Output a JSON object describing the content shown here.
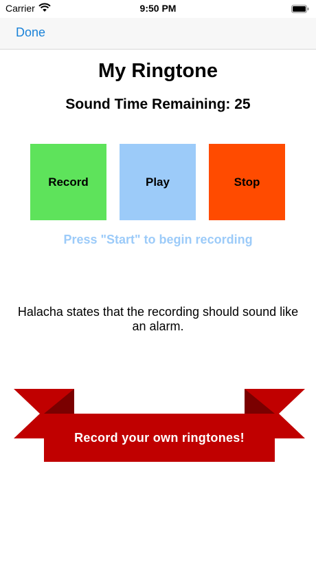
{
  "status_bar": {
    "carrier": "Carrier",
    "time": "9:50 PM",
    "icons": [
      "wifi-icon",
      "battery-icon"
    ]
  },
  "nav": {
    "done_label": "Done"
  },
  "title": "My Ringtone",
  "timer_text": "Sound Time Remaining: 25",
  "buttons": [
    {
      "label": "Record",
      "color": "#5ee35b"
    },
    {
      "label": "Play",
      "color": "#9ccbf9"
    },
    {
      "label": "Stop",
      "color": "#ff4b00"
    }
  ],
  "hint": "Press \"Start\" to begin recording",
  "note": "Halacha states that the recording should sound like an alarm.",
  "banner": {
    "text": "Record your own ringtones!",
    "color": "#c00000",
    "dark_color": "#7a0000"
  },
  "colors": {
    "accent": "#1a82d8",
    "hint": "#9ccbf9"
  }
}
